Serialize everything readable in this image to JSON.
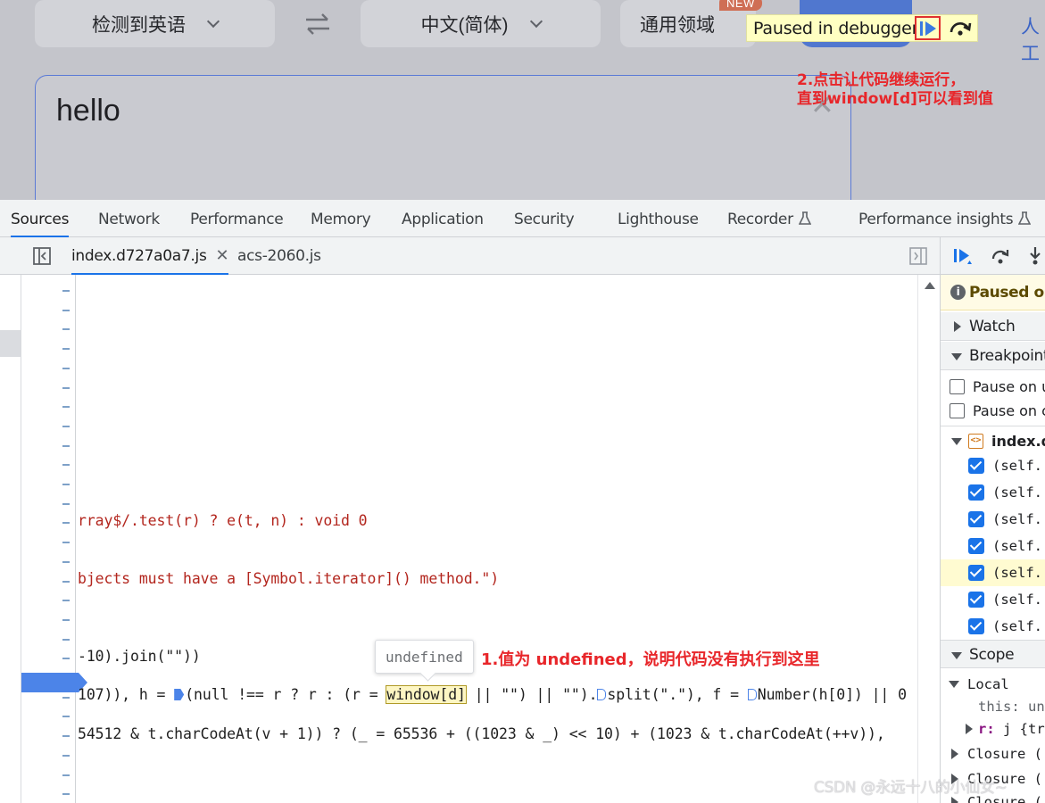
{
  "translator": {
    "source_lang": "检测到英语",
    "target_lang": "中文(简体)",
    "domain": "通用领域",
    "new_badge": "NEW",
    "ai_link": "人工",
    "input_text": "hello",
    "clear_symbol": "✕"
  },
  "debugger_overlay": {
    "paused_text": "Paused in debugger"
  },
  "annotations": {
    "resume_note_line1": "2.点击让代码继续运行，",
    "resume_note_line2": "直到window[d]可以看到值",
    "undefined_note": "1.值为 undefined，说明代码没有执行到这里"
  },
  "devtools": {
    "panel_tabs": [
      "Sources",
      "Network",
      "Performance",
      "Memory",
      "Application",
      "Security",
      "Lighthouse",
      "Recorder",
      "Performance insights"
    ],
    "active_panel": "Sources",
    "file_tabs": [
      "index.d727a0a7.js",
      "acs-2060.js"
    ],
    "active_file": "index.d727a0a7.js",
    "code": {
      "line1": "rray$/.test(r) ? e(t, n) : void 0",
      "line2": "bjects must have a [Symbol.iterator]() method.\")",
      "line3": "-10).join(\"\"))",
      "line4_a": "107)), h = ",
      "line4_b": "(null !== r ? r : (r = ",
      "line4_highlight": "window[d]",
      "line4_c": " || \"\") || \"\").",
      "line4_d": "split(\".\"), f = ",
      "line4_e": "Number(h[0]) || 0",
      "line5": "54512 & t.charCodeAt(v + 1)) ? (_ = 65536 + ((1023 & _) << 10) + (1023 & t.charCodeAt(++v)),"
    },
    "tooltip_value": "undefined"
  },
  "debug_sidebar": {
    "paused_label": "Paused on",
    "watch": "Watch",
    "breakpoints": "Breakpoints",
    "pause_options": [
      "Pause on uncaught exceptions",
      "Pause on caught exceptions"
    ],
    "breakpoint_file": "index.d",
    "breakpoint_items": [
      "(self.",
      "(self.",
      "(self.",
      "(self.",
      "(self.",
      "(self.",
      "(self."
    ],
    "scope": "Scope",
    "local": "Local",
    "local_this": "this: undefined",
    "local_r_key": "r:",
    "local_r_val": "j {tr",
    "closures": [
      "Closure (",
      "Closure (",
      "Closure ("
    ]
  },
  "watermark": "CSDN @永远十八的小仙女~",
  "colors": {
    "accent_blue": "#1a73e8",
    "annotation_red": "#e8262a",
    "paused_yellow": "#ffffc2"
  }
}
